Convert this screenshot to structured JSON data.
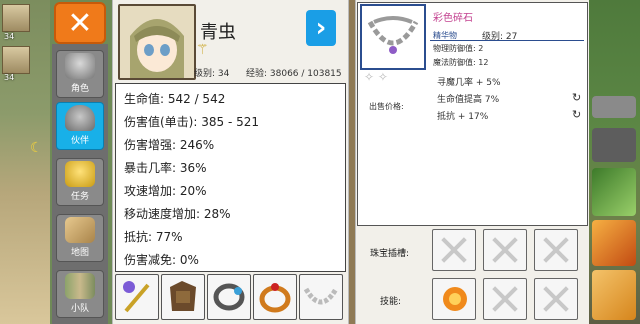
{
  "party": {
    "levels": [
      "34",
      "34"
    ]
  },
  "menu": {
    "close_icon": "✕",
    "items": [
      {
        "label": "角色",
        "icon": "helmet-icon"
      },
      {
        "label": "伙伴",
        "icon": "pot-helmet-icon"
      },
      {
        "label": "任务",
        "icon": "trophy-icon"
      },
      {
        "label": "地图",
        "icon": "scroll-map-icon"
      },
      {
        "label": "小队",
        "icon": "team-icon"
      }
    ]
  },
  "character": {
    "name": "青虫",
    "next_icon": "›",
    "level_text": "级别: 34",
    "exp_text": "经验: 38066 / 103815",
    "stats": [
      "生命值: 542 / 542",
      "伤害值(单击): 385 - 521",
      "伤害增强: 246%",
      "暴击几率: 36%",
      "攻速增加: 20%",
      "移动速度增加: 28%",
      "抵抗: 77%",
      "伤害减免: 0%"
    ]
  },
  "item": {
    "name": "彩色碎石",
    "type": "精华物",
    "level_text": "级别: 27",
    "phys_def": "物理防御值: 2",
    "magic_def": "魔法防御值: 12",
    "price_label": "出售价格:",
    "stats": [
      "寻魔几率 + 5%",
      "生命值提高 7%",
      "抵抗 + 17%"
    ]
  },
  "sockets": {
    "label": "珠宝插槽:"
  },
  "skills": {
    "label": "技能:"
  },
  "colors": {
    "accent_orange": "#f07a1a",
    "accent_blue": "#1a9ee6",
    "item_name_pink": "#c23f8e",
    "item_type_blue": "#2b4d8f"
  }
}
